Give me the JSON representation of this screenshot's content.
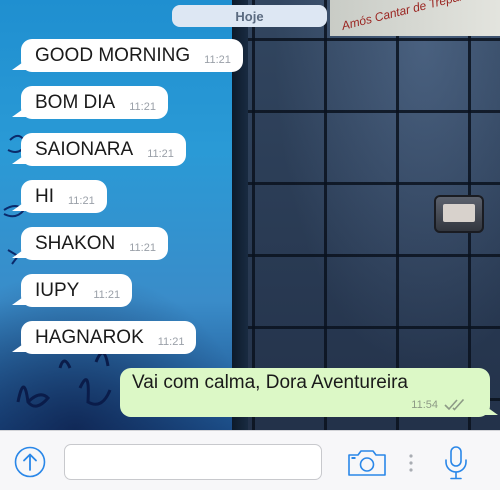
{
  "chat": {
    "date_label": "Hoje",
    "incoming": [
      {
        "text": "GOOD MORNING",
        "time": "11:21"
      },
      {
        "text": "BOM DIA",
        "time": "11:21"
      },
      {
        "text": "SAIONARA",
        "time": "11:21"
      },
      {
        "text": "HI",
        "time": "11:21"
      },
      {
        "text": "SHAKON",
        "time": "11:21"
      },
      {
        "text": "IUPY",
        "time": "11:21"
      },
      {
        "text": "HAGNAROK",
        "time": "11:21"
      }
    ],
    "outgoing": {
      "text": "Vai com calma, Dora Aventureira",
      "time": "11:54",
      "status": "read",
      "status_icon": "double-check-icon"
    }
  },
  "wallpaper": {
    "graffiti_text": "Amós  Cantar de Trepar"
  },
  "input_bar": {
    "message_value": "",
    "share_icon": "share-arrow-up-icon",
    "camera_icon": "camera-icon",
    "mic_icon": "microphone-icon"
  },
  "colors": {
    "accent": "#2a87e8",
    "incoming_bubble": "#ffffff",
    "outgoing_bubble": "#dcf8c6",
    "date_pill": "#dde7f3"
  }
}
